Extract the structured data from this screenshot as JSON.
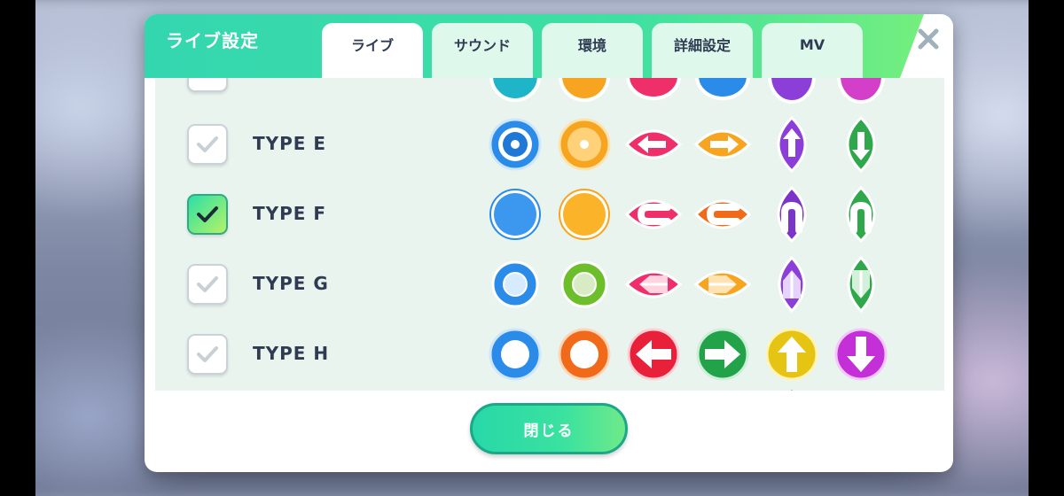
{
  "dialog": {
    "title": "ライブ設定",
    "close_icon": "close-icon"
  },
  "tabs": [
    {
      "label": "ライブ",
      "active": true
    },
    {
      "label": "サウンド",
      "active": false
    },
    {
      "label": "環境",
      "active": false
    },
    {
      "label": "詳細設定",
      "active": false
    },
    {
      "label": "MV",
      "active": false
    }
  ],
  "note_types": [
    {
      "label": "TYPE E",
      "checked": false
    },
    {
      "label": "TYPE F",
      "checked": true
    },
    {
      "label": "TYPE G",
      "checked": false
    },
    {
      "label": "TYPE H",
      "checked": false
    }
  ],
  "footer": {
    "close_label": "閉じる"
  },
  "colors": {
    "accent": "#34d6b0",
    "text": "#2f3b52",
    "note_blue": "#2b8be8",
    "note_orange": "#f7a520",
    "note_pink": "#ee2f6a",
    "note_purple": "#8b3ed8",
    "note_green": "#2ea84b"
  }
}
